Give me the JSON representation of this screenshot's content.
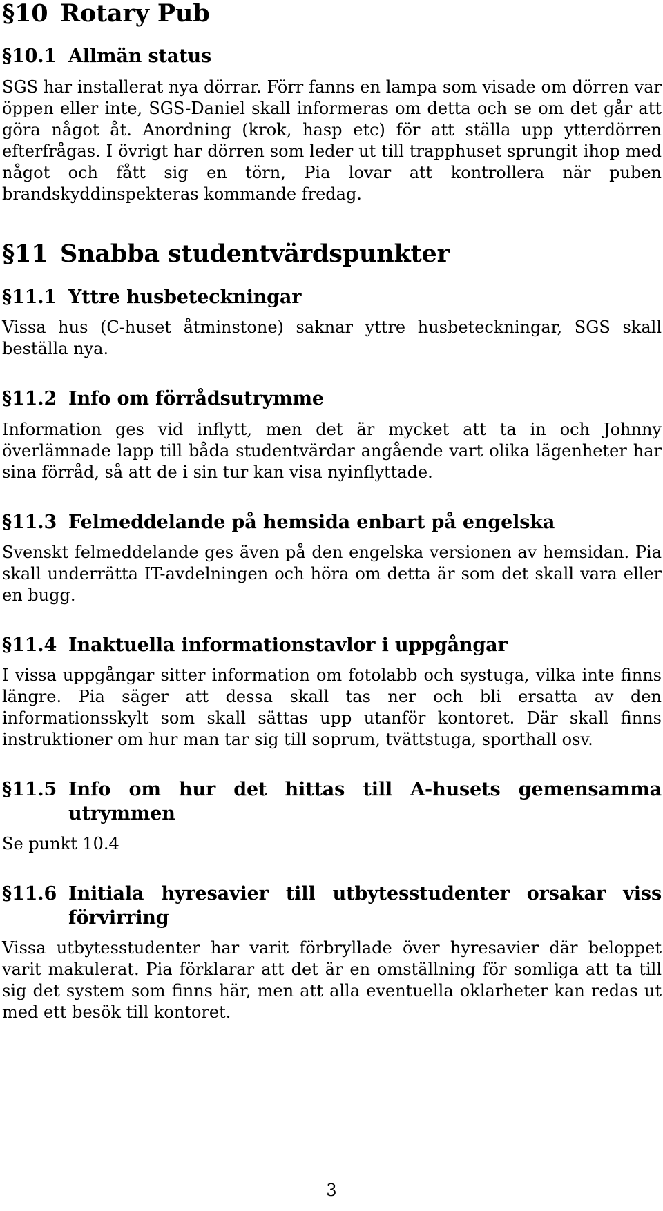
{
  "document": {
    "page_number": "3",
    "language": "sv"
  },
  "sections": [
    {
      "number": "§10",
      "title": "Rotary Pub",
      "subsections": [
        {
          "number": "§10.1",
          "title": "Allmän status",
          "body": "SGS har installerat nya dörrar. Förr fanns en lampa som visade om dörren var öppen eller inte, SGS-Daniel skall informeras om detta och se om det går att göra något åt. Anordning (krok, hasp etc) för att ställa upp ytterdörren efterfrågas. I övrigt har dörren som leder ut till trapphuset sprungit ihop med något och fått sig en törn, Pia lovar att kontrollera när puben brandskyddinspekteras kommande fredag."
        }
      ]
    },
    {
      "number": "§11",
      "title": "Snabba studentvärdspunkter",
      "subsections": [
        {
          "number": "§11.1",
          "title": "Yttre husbeteckningar",
          "body": "Vissa hus (C-huset åtminstone) saknar yttre husbeteckningar, SGS skall beställa nya."
        },
        {
          "number": "§11.2",
          "title": "Info om förrådsutrymme",
          "body": "Information ges vid inflytt, men det är mycket att ta in och Johnny överlämnade lapp till båda studentvärdar angående vart olika lägenheter har sina förråd, så att de i sin tur kan visa nyinflyttade."
        },
        {
          "number": "§11.3",
          "title": "Felmeddelande på hemsida enbart på engelska",
          "body": "Svenskt felmeddelande ges även på den engelska versionen av hemsidan. Pia skall underrätta IT-avdelningen och höra om detta är som det skall vara eller en bugg."
        },
        {
          "number": "§11.4",
          "title": "Inaktuella informationstavlor i uppgångar",
          "body": "I vissa uppgångar sitter information om fotolabb och systuga, vilka inte finns längre. Pia säger att dessa skall tas ner och bli ersatta av den informationsskylt som skall sättas upp utanför kontoret. Där skall finns instruktioner om hur man tar sig till soprum, tvättstuga, sporthall osv."
        },
        {
          "number": "§11.5",
          "title_line1": "Info om hur det hittas till A-husets gemensamma",
          "title_line2": "utrymmen",
          "body": "Se punkt 10.4"
        },
        {
          "number": "§11.6",
          "title_line1": "Initiala hyresavier till utbytesstudenter orsakar viss",
          "title_line2": "förvirring",
          "body": "Vissa utbytesstudenter har varit förbryllade över hyresavier där beloppet varit makulerat. Pia förklarar att det är en omställning för somliga att ta till sig det system som finns här, men att alla eventuella oklarheter kan redas ut med ett besök till kontoret."
        }
      ]
    }
  ]
}
